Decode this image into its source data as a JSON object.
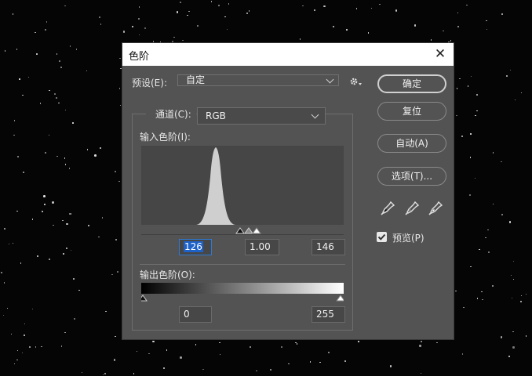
{
  "dialog": {
    "title": "色阶",
    "close_glyph": "✕",
    "preset_label": "预设(E):",
    "preset_value": "自定",
    "channel_label": "通道(C):",
    "channel_value": "RGB",
    "input_levels_label": "输入色阶(I):",
    "output_levels_label": "输出色阶(O):",
    "input_black": "126",
    "input_gamma": "1.00",
    "input_white": "146",
    "output_black": "0",
    "output_white": "255",
    "preview_label": "预览(P)",
    "preview_checked": true
  },
  "buttons": {
    "ok": "确定",
    "reset": "复位",
    "auto": "自动(A)",
    "options": "选项(T)..."
  },
  "icons": {
    "close": "close-icon",
    "gear": "gear-icon",
    "chevron": "chevron-down-icon",
    "eyedropper_black": "eyedropper-black-icon",
    "eyedropper_gray": "eyedropper-gray-icon",
    "eyedropper_white": "eyedropper-white-icon"
  },
  "colors": {
    "dialog_bg": "#535353",
    "title_bg": "#ffffff",
    "histogram_fill": "#cfcfcf",
    "selection": "#1e62c8"
  }
}
